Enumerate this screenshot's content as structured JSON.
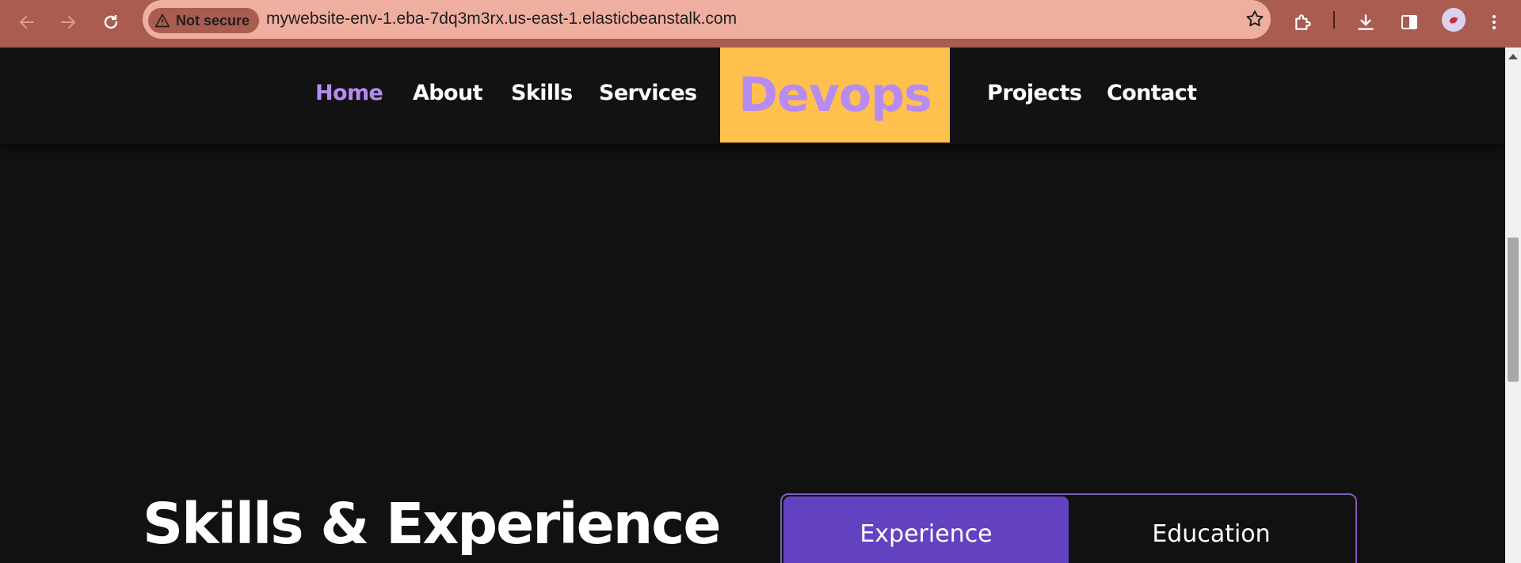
{
  "browser": {
    "security_chip": "Not secure",
    "url": "mywebsite-env-1.eba-7dq3m3rx.us-east-1.elasticbeanstalk.com",
    "icons": [
      "back-icon",
      "forward-icon",
      "reload-icon",
      "warning-icon",
      "star-icon",
      "extensions-icon",
      "download-icon",
      "side-panel-icon",
      "profile-avatar",
      "menu-icon"
    ]
  },
  "nav": {
    "links_left": [
      "Home",
      "About",
      "Skills",
      "Services"
    ],
    "logo": "Devops",
    "links_right": [
      "Projects",
      "Contact"
    ],
    "active": "Home"
  },
  "section": {
    "title": "Skills & Experience"
  },
  "tabs": {
    "items": [
      "Experience",
      "Education"
    ],
    "active": "Experience"
  },
  "colors": {
    "toolbar": "#a95c4f",
    "omnibox": "#eeaea0",
    "page_background": "#111111",
    "accent_purple": "#b68cf2",
    "logo_background": "#ffc04e",
    "tab_active": "#6342c2",
    "tab_border": "#7e5bbf"
  }
}
